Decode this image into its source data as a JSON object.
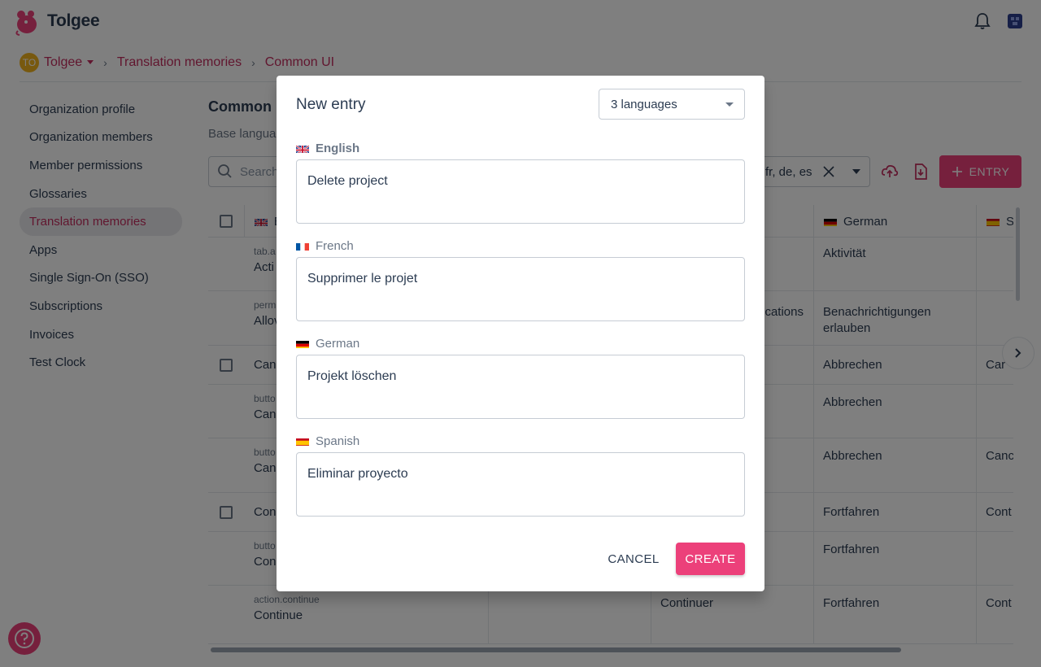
{
  "app": {
    "name": "Tolgee"
  },
  "breadcrumb": {
    "org_initials": "TO",
    "org": "Tolgee",
    "section": "Translation memories",
    "current": "Common UI"
  },
  "sidebar": {
    "items": [
      {
        "label": "Organization profile"
      },
      {
        "label": "Organization members"
      },
      {
        "label": "Member permissions"
      },
      {
        "label": "Glossaries"
      },
      {
        "label": "Translation memories",
        "active": true
      },
      {
        "label": "Apps"
      },
      {
        "label": "Single Sign-On (SSO)"
      },
      {
        "label": "Subscriptions"
      },
      {
        "label": "Invoices"
      },
      {
        "label": "Test Clock"
      }
    ]
  },
  "main": {
    "title": "Common U",
    "subtitle": "Base langua",
    "search_placeholder": "Search",
    "language_filter": "fr, de, es",
    "entry_button": "ENTRY"
  },
  "table": {
    "headers": [
      "E",
      "",
      "",
      "German",
      "S"
    ],
    "rows": [
      {
        "checkbox": false,
        "key": "tab.a",
        "base": "Acti",
        "fr": "",
        "german": "Aktivität",
        "es": ""
      },
      {
        "checkbox": false,
        "key": "perm",
        "base": "Allov",
        "fr": "cations",
        "german": "Benachrichtigungen erlauben",
        "es": ""
      },
      {
        "checkbox": true,
        "key": "",
        "base": "Canc",
        "fr": "",
        "german": "Abbrechen",
        "es": "Car"
      },
      {
        "checkbox": false,
        "key": "butto",
        "base": "Canc",
        "fr": "",
        "german": "Abbrechen",
        "es": ""
      },
      {
        "checkbox": false,
        "key": "butto",
        "base": "Canc",
        "fr": "",
        "german": "Abbrechen",
        "es": "Canc"
      },
      {
        "checkbox": true,
        "key": "",
        "base": "Con",
        "fr": "",
        "german": "Fortfahren",
        "es": "Cont"
      },
      {
        "checkbox": false,
        "key": "butto",
        "base": "Con",
        "fr": "",
        "german": "Fortfahren",
        "es": ""
      },
      {
        "checkbox": false,
        "key": "action.continue",
        "base": "Continue",
        "fr": "Continuer",
        "german": "Fortfahren",
        "es": "Cont"
      }
    ]
  },
  "dialog": {
    "title": "New entry",
    "language_select": "3 languages",
    "fields": [
      {
        "language": "English",
        "flag": "uk-flag",
        "value": "Delete project"
      },
      {
        "language": "French",
        "flag": "fr-flag",
        "value": "Supprimer le projet"
      },
      {
        "language": "German",
        "flag": "de-flag",
        "value": "Projekt löschen"
      },
      {
        "language": "Spanish",
        "flag": "es-flag",
        "value": "Eliminar proyecto"
      }
    ],
    "cancel_label": "CANCEL",
    "create_label": "CREATE"
  },
  "colors": {
    "accent": "#ec407a",
    "accent_text": "#c32d5e",
    "text": "#2c3c52"
  }
}
